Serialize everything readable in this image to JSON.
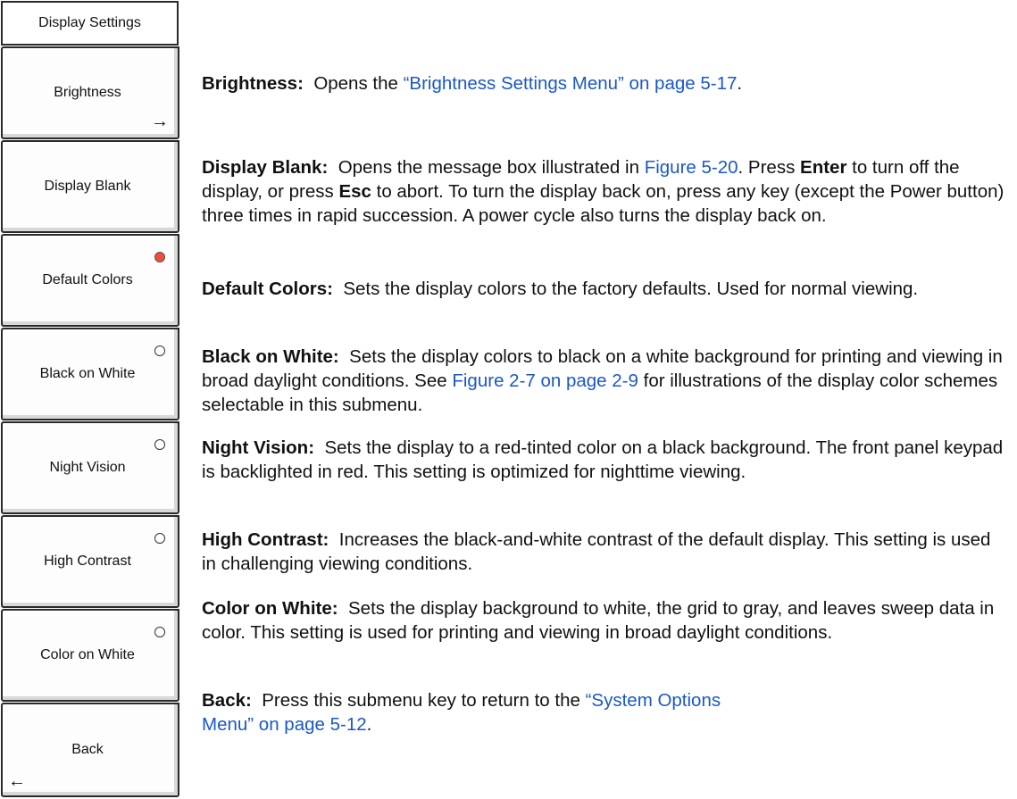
{
  "menu": {
    "title": "Display Settings",
    "keys": [
      {
        "label": "Brightness",
        "arrow": "→",
        "icon": "arrow-right-icon"
      },
      {
        "label": "Display Blank"
      },
      {
        "label": "Default Colors",
        "selected": true
      },
      {
        "label": "Black on White",
        "selected": false
      },
      {
        "label": "Night Vision",
        "selected": false
      },
      {
        "label": "High Contrast",
        "selected": false
      },
      {
        "label": "Color on White",
        "selected": false
      },
      {
        "label": "Back",
        "arrow": "←",
        "icon": "arrow-left-icon"
      }
    ]
  },
  "descriptions": {
    "brightness": {
      "term": "Brightness:",
      "text": "Opens the ",
      "link": "“Brightness Settings Menu” on page 5-17",
      "tail": "."
    },
    "display_blank": {
      "term": "Display Blank:",
      "text1": "Opens the message box illustrated in ",
      "link": "Figure 5-20",
      "text2": ". Press ",
      "key_enter": "Enter",
      "text3": " to turn off the display, or press ",
      "key_esc": "Esc",
      "text4": " to abort. To turn the display back on, press any key (except the Power button) three times in rapid succession. A power cycle also turns the display back on."
    },
    "default_colors": {
      "term": "Default Colors:",
      "text": "Sets the display colors to the factory defaults. Used for normal viewing."
    },
    "black_on_white": {
      "term": "Black on White:",
      "text1": "Sets the display colors to black on a white background for printing and viewing in broad daylight conditions. See ",
      "link": "Figure 2-7 on page 2-9",
      "text2": " for illustrations of the display color schemes selectable in this submenu."
    },
    "night_vision": {
      "term": "Night Vision:",
      "text": "Sets the display to a red-tinted color on a black background. The front panel keypad is backlighted in red. This setting is optimized for nighttime viewing."
    },
    "high_contrast": {
      "term": "High Contrast:",
      "text": "Increases the black-and-white contrast of the default display. This setting is used in challenging viewing conditions."
    },
    "color_on_white": {
      "term": "Color on White:",
      "text": "Sets the display background to white, the grid to gray, and leaves sweep data in color. This setting is used for printing and viewing in broad daylight conditions."
    },
    "back": {
      "term": "Back:",
      "text": "Press this submenu key to return to the ",
      "link": "“System Options Menu” on page 5-12",
      "tail": "."
    }
  },
  "colors": {
    "link": "#1a57c9",
    "selected_radio": "#f04e3a"
  }
}
